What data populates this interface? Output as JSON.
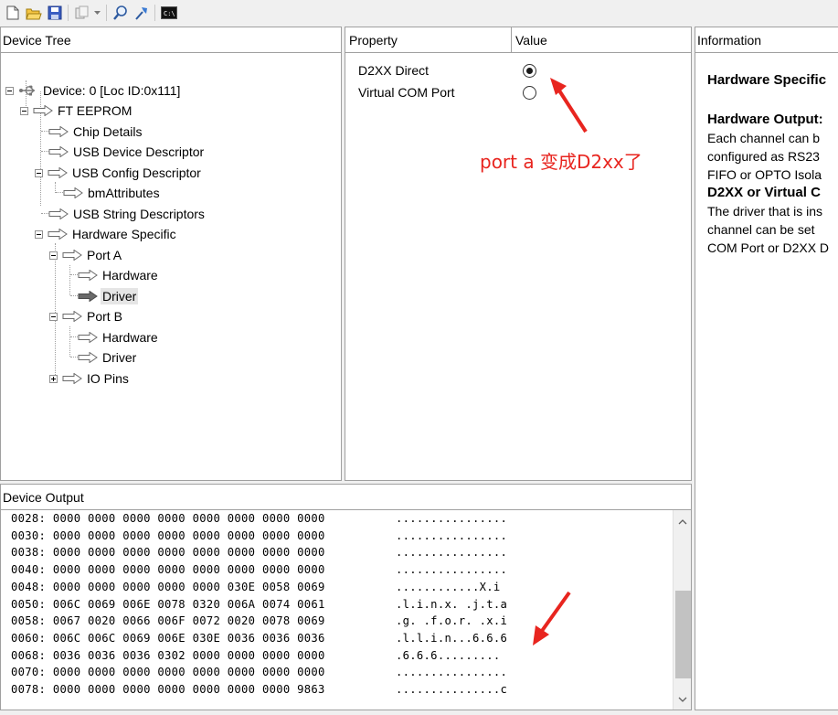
{
  "toolbar": {
    "buttons": [
      "new-icon",
      "open-folder-icon",
      "save-icon",
      "copy-icon",
      "dropdown-icon",
      "search-icon",
      "program-icon",
      "console-icon"
    ]
  },
  "device_tree": {
    "header": "Device Tree",
    "nodes": [
      {
        "label": "Device: 0 [Loc ID:0x111]"
      },
      {
        "label": "FT EEPROM"
      },
      {
        "label": "Chip Details"
      },
      {
        "label": "USB Device Descriptor"
      },
      {
        "label": "USB Config Descriptor"
      },
      {
        "label": "bmAttributes"
      },
      {
        "label": "USB String Descriptors"
      },
      {
        "label": "Hardware Specific"
      },
      {
        "label": "Port A"
      },
      {
        "label": "Hardware"
      },
      {
        "label": "Driver"
      },
      {
        "label": "Port B"
      },
      {
        "label": "Hardware"
      },
      {
        "label": "Driver"
      },
      {
        "label": "IO Pins"
      }
    ]
  },
  "property_panel": {
    "col_property": "Property",
    "col_value": "Value",
    "rows": [
      {
        "name": "D2XX Direct",
        "checked": true
      },
      {
        "name": "Virtual COM Port",
        "checked": false
      }
    ],
    "annotation": "port a 变成D2xx了",
    "annotation_color": "#e8251f"
  },
  "info_panel": {
    "header": "Information",
    "title": "Hardware Specific",
    "output_heading": "Hardware Output:",
    "text_lines": [
      "Each channel can b",
      "configured as RS23",
      "FIFO or OPTO Isola"
    ],
    "d2xx_heading": "D2XX or Virtual C",
    "text_lines2": [
      "The driver that is ins",
      "channel can be set",
      "COM Port or D2XX D"
    ]
  },
  "device_output": {
    "header": "Device Output",
    "lines": [
      {
        "hex": "0028: 0000 0000 0000 0000 0000 0000 0000 0000",
        "ascii": "................"
      },
      {
        "hex": "0030: 0000 0000 0000 0000 0000 0000 0000 0000",
        "ascii": "................"
      },
      {
        "hex": "0038: 0000 0000 0000 0000 0000 0000 0000 0000",
        "ascii": "................"
      },
      {
        "hex": "0040: 0000 0000 0000 0000 0000 0000 0000 0000",
        "ascii": "................"
      },
      {
        "hex": "0048: 0000 0000 0000 0000 0000 030E 0058 0069",
        "ascii": "............X.i"
      },
      {
        "hex": "0050: 006C 0069 006E 0078 0320 006A 0074 0061",
        "ascii": ".l.i.n.x. .j.t.a"
      },
      {
        "hex": "0058: 0067 0020 0066 006F 0072 0020 0078 0069",
        "ascii": ".g. .f.o.r. .x.i"
      },
      {
        "hex": "0060: 006C 006C 0069 006E 030E 0036 0036 0036",
        "ascii": ".l.l.i.n...6.6.6"
      },
      {
        "hex": "0068: 0036 0036 0036 0302 0000 0000 0000 0000",
        "ascii": ".6.6.6........."
      },
      {
        "hex": "0070: 0000 0000 0000 0000 0000 0000 0000 0000",
        "ascii": "................"
      },
      {
        "hex": "0078: 0000 0000 0000 0000 0000 0000 0000 9863",
        "ascii": "...............c"
      }
    ]
  }
}
